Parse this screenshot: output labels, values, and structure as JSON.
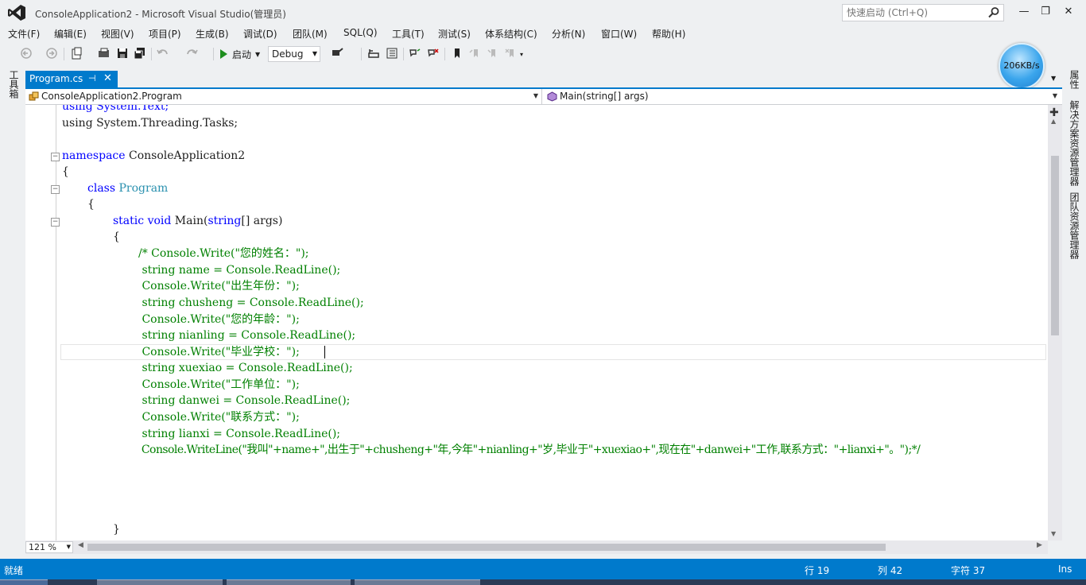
{
  "window": {
    "title": "ConsoleApplication2 - Microsoft Visual Studio(管理员)",
    "quick_launch_placeholder": "快速启动 (Ctrl+Q)",
    "minimize": "—",
    "restore": "❐",
    "close": "✕"
  },
  "menu": [
    "文件(F)",
    "编辑(E)",
    "视图(V)",
    "项目(P)",
    "生成(B)",
    "调试(D)",
    "团队(M)",
    "SQL(Q)",
    "工具(T)",
    "测试(S)",
    "体系结构(C)",
    "分析(N)",
    "窗口(W)",
    "帮助(H)"
  ],
  "toolbar": {
    "start_label": "启动",
    "config_value": "Debug"
  },
  "network_speed": "206KB/s",
  "left_strip": {
    "toolbox_label": "工具箱"
  },
  "right_strip": {
    "properties_label": "属性",
    "solution_explorer_label": "解决方案资源管理器",
    "team_explorer_label": "团队资源管理器"
  },
  "document_tab": {
    "name": "Program.cs",
    "pin": "⊣",
    "close": "✕"
  },
  "navbar": {
    "type_scope": "ConsoleApplication2.Program",
    "member_scope": "Main(string[] args)"
  },
  "code": {
    "l0": "using System.Text;",
    "l1": "using System.Threading.Tasks;",
    "l3_kw": "namespace",
    "l3_rest": " ConsoleApplication2",
    "l4": "{",
    "l5_kw": "class",
    "l5_type": "Program",
    "l6": "{",
    "l7_kw1": "static",
    "l7_kw2": "void",
    "l7_mid": " Main(",
    "l7_kw3": "string",
    "l7_rest": "[] args)",
    "l8": "{",
    "c1": "/* Console.Write(\"您的姓名：\");",
    "c2": " string name = Console.ReadLine();",
    "c3": " Console.Write(\"出生年份：\");",
    "c4": " string chusheng = Console.ReadLine();",
    "c5": " Console.Write(\"您的年龄：\");",
    "c6": " string nianling = Console.ReadLine();",
    "c7": " Console.Write(\"毕业学校：\");",
    "c8": " string xuexiao = Console.ReadLine();",
    "c9": " Console.Write(\"工作单位：\");",
    "c10": " string danwei = Console.ReadLine();",
    "c11": " Console.Write(\"联系方式：\");",
    "c12": " string lianxi = Console.ReadLine();",
    "c13": " Console.WriteLine(\"我叫\"+name+\",出生于\"+chusheng+\"年,今年\"+nianling+\"岁,毕业于\"+xuexiao+\",现在在\"+danwei+\"工作,联系方式：\"+lianxi+\"。\");*/",
    "l_close": "}"
  },
  "zoom": "121 %",
  "status": {
    "ready": "就绪",
    "line": "行 19",
    "col": "列 42",
    "char": "字符 37",
    "mode": "Ins"
  },
  "colors": {
    "accent": "#007acc",
    "keyword": "#0000ff",
    "type": "#2b91af",
    "comment": "#008000"
  }
}
